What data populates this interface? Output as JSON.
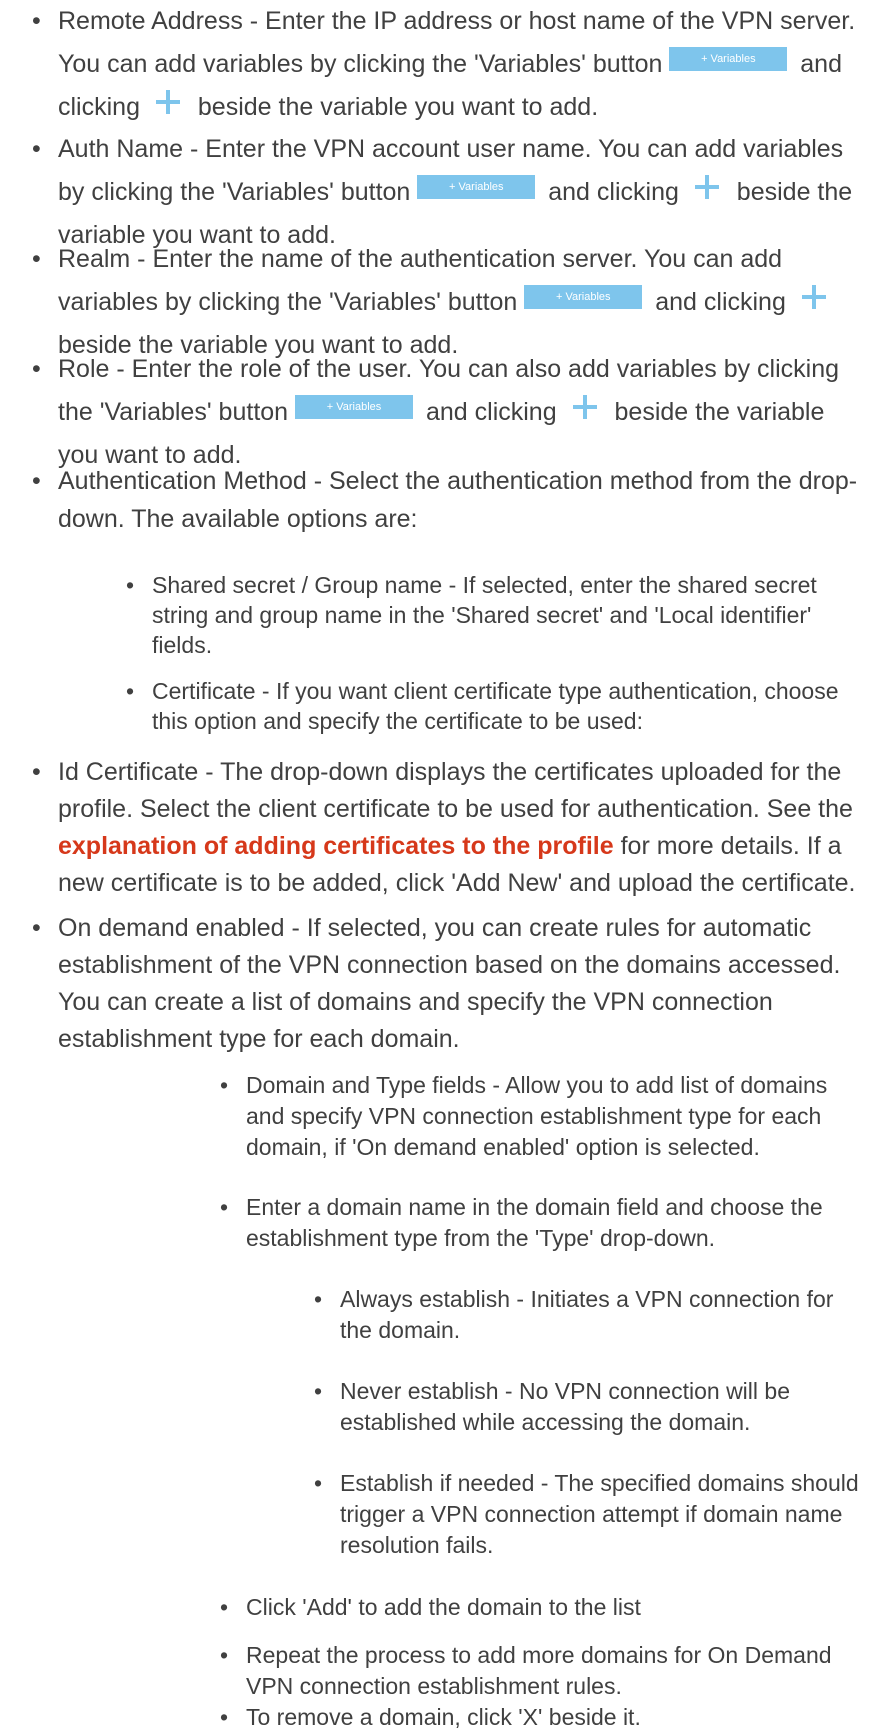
{
  "bullet_char": "•",
  "variables_button_label": "+ Variables",
  "items": {
    "remote_address": {
      "t1": "Remote Address - Enter the IP address or host name of the VPN server. You can add variables by clicking the 'Variables' button",
      "t2": "and clicking",
      "t3": "beside the variable you want to add."
    },
    "auth_name": {
      "t1": "Auth Name - Enter the VPN account user name. You can add variables by clicking the 'Variables' button",
      "t2": "and clicking",
      "t3": "beside the variable you want to add."
    },
    "realm": {
      "t1": "Realm - Enter the name of the authentication server. You can add variables by clicking the 'Variables' button",
      "t2": "and clicking",
      "t3": "beside the variable you want to add."
    },
    "role": {
      "t1": "Role - Enter the role of the user. You can also add variables by clicking the 'Variables' button",
      "t2": "and clicking",
      "t3": "beside the variable you want to add."
    },
    "auth_method": {
      "text": "Authentication Method - Select the authentication method from the drop-down. The available options are:",
      "options": [
        "Shared secret / Group name - If selected, enter the shared secret string and group name in the 'Shared secret' and 'Local identifier' fields.",
        "Certificate - If you want client certificate type authentication, choose this option and specify the certificate to be used:"
      ]
    },
    "id_certificate": {
      "t1": "Id Certificate - The drop-down displays the certificates uploaded for the profile. Select the client certificate to be used for authentication. See the",
      "link": "explanation of adding certificates to the profile",
      "t2": "for more details. If a new certificate is to be added, click 'Add New' and upload the certificate."
    },
    "on_demand": {
      "text": "On demand enabled - If selected, you can create rules for automatic establishment of the VPN connection based on the domains accessed. You can create a list of domains and specify the VPN connection establishment type for each domain.",
      "sub": [
        "Domain and Type fields - Allow you to add list of domains and specify VPN connection establishment type for each domain, if 'On demand enabled' option is selected.",
        "Enter a domain name in the domain field and choose the establishment type from the 'Type' drop-down."
      ],
      "types": [
        "Always establish - Initiates a VPN connection for the domain.",
        "Never establish - No VPN connection will be established while accessing the domain.",
        "Establish if needed - The specified domains should trigger a VPN connection attempt if domain name resolution fails."
      ],
      "steps": [
        "Click 'Add' to add the domain to the list",
        "Repeat the process to add more domains for On Demand VPN connection establishment rules.",
        "To remove a domain, click 'X' beside it."
      ]
    }
  },
  "colors": {
    "text": "#404040",
    "button": "#7ec5ec",
    "plus": "#7ec5ec",
    "link": "#d6381a"
  }
}
